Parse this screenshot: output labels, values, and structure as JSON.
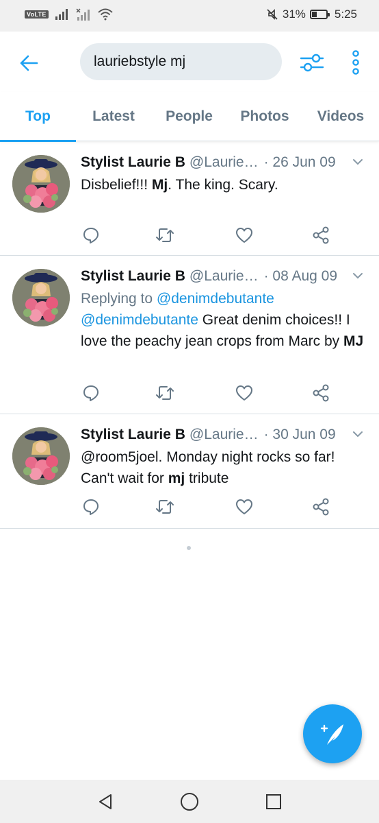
{
  "status_bar": {
    "volte": "VoLTE",
    "battery_percent": "31%",
    "time": "5:25"
  },
  "header": {
    "search_value": "lauriebstyle mj",
    "accent_color": "#1da1f2"
  },
  "tabs": [
    {
      "label": "Top",
      "active": true
    },
    {
      "label": "Latest",
      "active": false
    },
    {
      "label": "People",
      "active": false
    },
    {
      "label": "Photos",
      "active": false
    },
    {
      "label": "Videos",
      "active": false
    }
  ],
  "tweets": [
    {
      "name": "Stylist Laurie B",
      "handle": "@Laurie…",
      "date": "· 26 Jun 09",
      "text_1": "Disbelief!!!  ",
      "bold_1": "Mj",
      "text_2": ". The king. Scary."
    },
    {
      "name": "Stylist Laurie B",
      "handle": "@Laurie…",
      "date": "· 08 Aug 09",
      "replying_label": "Replying to ",
      "replying_to": "@denimdebutante",
      "mention": "@denimdebutante",
      "text_1": " Great denim choices!! I love the peachy jean crops from Marc by ",
      "bold_1": "MJ"
    },
    {
      "name": "Stylist Laurie B",
      "handle": "@Laurie…",
      "date": "· 30 Jun 09",
      "text_1": "@room5joel. Monday night rocks so far! Can't wait for ",
      "bold_1": "mj",
      "text_2": " tribute"
    }
  ],
  "icons": {
    "back": "arrow-left-icon",
    "filter": "sliders-icon",
    "more": "more-vertical-icon",
    "reply": "comment-icon",
    "retweet": "retweet-icon",
    "like": "heart-icon",
    "share": "share-icon",
    "compose": "feather-plus-icon"
  }
}
